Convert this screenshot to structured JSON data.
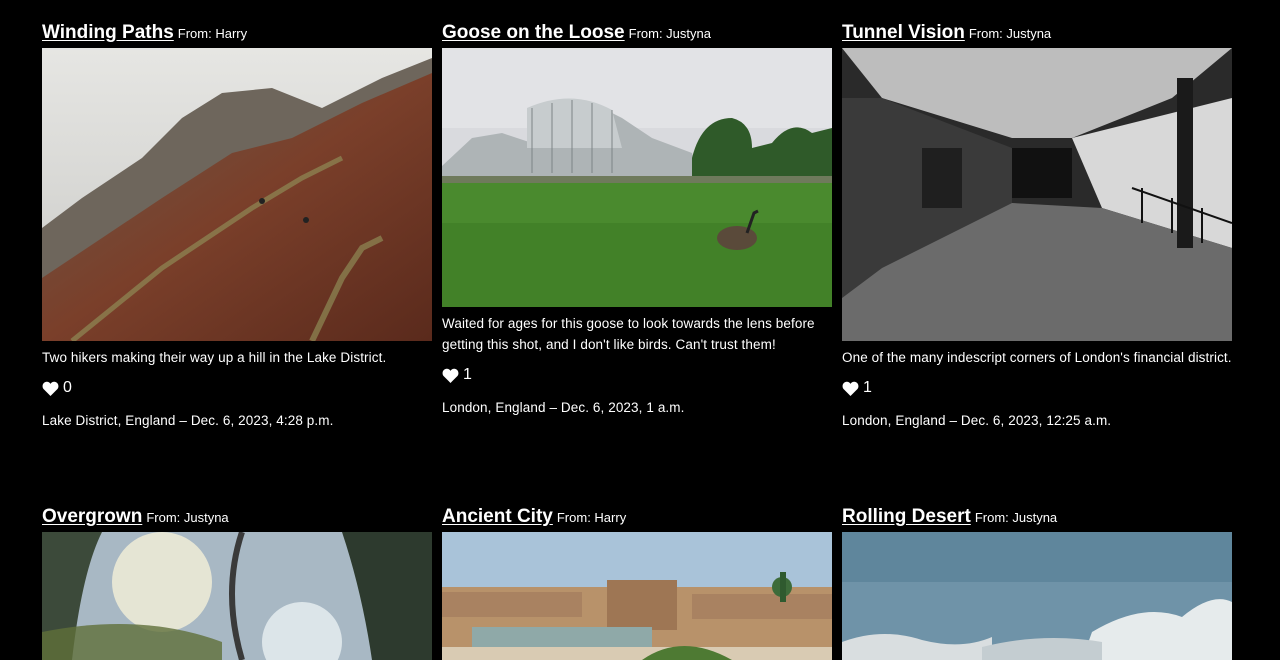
{
  "posts": [
    {
      "title": "Winding Paths",
      "from": "From: Harry",
      "description": "Two hikers making their way up a hill in the Lake District.",
      "likes": "0",
      "meta": "Lake District, England – Dec. 6, 2023, 4:28 p.m."
    },
    {
      "title": "Goose on the Loose",
      "from": "From: Justyna",
      "description": "Waited for ages for this goose to look towards the lens before getting this shot, and I don't like birds. Can't trust them!",
      "likes": "1",
      "meta": "London, England – Dec. 6, 2023, 1 a.m."
    },
    {
      "title": "Tunnel Vision",
      "from": "From: Justyna",
      "description": "One of the many indescript corners of London's financial district.",
      "likes": "1",
      "meta": "London, England – Dec. 6, 2023, 12:25 a.m."
    },
    {
      "title": "Overgrown",
      "from": "From: Justyna"
    },
    {
      "title": "Ancient City",
      "from": "From: Harry"
    },
    {
      "title": "Rolling Desert",
      "from": "From: Justyna"
    }
  ],
  "icons": {
    "like": "heart-icon"
  }
}
